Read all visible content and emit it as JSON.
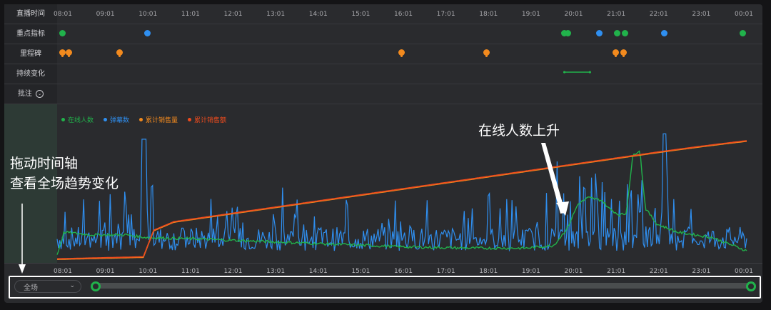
{
  "rows": {
    "header": "直播时间",
    "key_metrics": "重点指标",
    "milestones": "里程碑",
    "continuous_change": "持续变化",
    "notes": "批注"
  },
  "time_ticks": [
    "08:01",
    "09:01",
    "10:01",
    "11:01",
    "12:01",
    "13:01",
    "14:01",
    "15:01",
    "16:01",
    "17:01",
    "18:01",
    "19:01",
    "20:01",
    "21:01",
    "22:01",
    "23:01",
    "00:01"
  ],
  "colors": {
    "online": "#21b24b",
    "danmu": "#2f8ff0",
    "cum_sales_qty": "#f28a1e",
    "cum_sales_amt": "#ee4b1d",
    "annotation_text": "#ffffff"
  },
  "key_metric_events": [
    {
      "time": "08:00",
      "color": "green"
    },
    {
      "time": "10:00",
      "color": "blue"
    },
    {
      "time": "19:48",
      "color": "green"
    },
    {
      "time": "19:53",
      "color": "green"
    },
    {
      "time": "20:37",
      "color": "blue"
    },
    {
      "time": "21:02",
      "color": "green"
    },
    {
      "time": "21:13",
      "color": "green"
    },
    {
      "time": "22:09",
      "color": "blue"
    },
    {
      "time": "23:59",
      "color": "green"
    }
  ],
  "milestone_events": [
    "08:00",
    "08:10",
    "09:21",
    "15:58",
    "17:58",
    "21:00",
    "21:11"
  ],
  "continuous_change_range": [
    "19:48",
    "20:24"
  ],
  "notes_icon": "chevron-circle-icon",
  "chart_data": {
    "type": "line",
    "series": [
      {
        "name": "在线人数"
      },
      {
        "name": "弹幕数"
      },
      {
        "name": "累计销售量"
      },
      {
        "name": "累计销售额"
      }
    ],
    "x": [
      "08:01",
      "09:01",
      "10:01",
      "11:01",
      "12:01",
      "13:01",
      "14:01",
      "15:01",
      "16:01",
      "17:01",
      "18:01",
      "19:01",
      "20:01",
      "21:01",
      "22:01",
      "23:01",
      "00:01"
    ],
    "legend_position": "top-left",
    "grid": false
  },
  "annotations": {
    "left_line1": "拖动时间轴",
    "left_line2": "查看全场趋势变化",
    "right": "在线人数上升"
  },
  "range_select": {
    "value": "全场"
  }
}
